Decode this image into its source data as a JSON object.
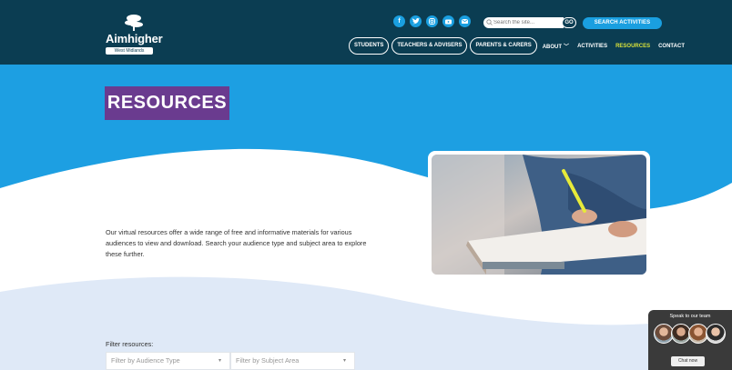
{
  "brand": {
    "name": "Aimhigher",
    "subtitle": "West Midlands"
  },
  "social": [
    "facebook-icon",
    "twitter-icon",
    "instagram-icon",
    "youtube-icon",
    "email-icon"
  ],
  "search": {
    "placeholder": "Search the site...",
    "go_label": "GO",
    "activities_label": "SEARCH ACTIVITIES"
  },
  "nav": {
    "students": "STUDENTS",
    "teachers": "TEACHERS & ADVISERS",
    "parents": "PARENTS & CARERS",
    "about": "ABOUT",
    "activities": "ACTIVITIES",
    "resources": "RESOURCES",
    "contact": "CONTACT"
  },
  "page": {
    "title": "RESOURCES",
    "intro": "Our virtual resources offer a wide range of free and informative materials for various audiences to view and download. Search your audience type and subject area to explore these further."
  },
  "filters": {
    "label": "Filter resources:",
    "audience_placeholder": "Filter by Audience Type",
    "subject_placeholder": "Filter by Subject Area"
  },
  "chat": {
    "title": "Speak to our team",
    "button": "Chat now"
  },
  "colors": {
    "header_bg": "#0b3d52",
    "accent_blue": "#1a9fe0",
    "title_purple": "#6a3b8f",
    "active_nav": "#d9e23a"
  }
}
